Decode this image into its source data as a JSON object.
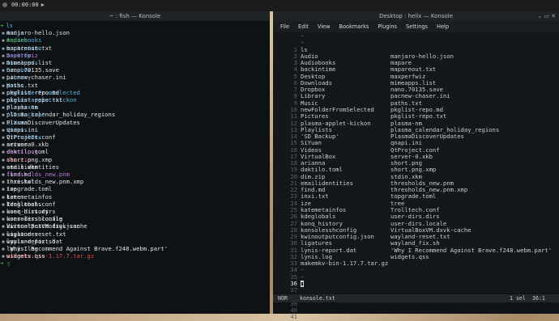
{
  "topbar": {
    "time": "00:00:00"
  },
  "left_window": {
    "title": "~ : fish — Konsole",
    "prompt_arrow": "➜",
    "command": "ls",
    "col1": [
      {
        "t": "Audio",
        "c": "dir"
      },
      {
        "t": "Audiobooks",
        "c": "dir"
      },
      {
        "t": "backintime",
        "c": "dir"
      },
      {
        "t": "Desktop",
        "c": "dir"
      },
      {
        "t": "Downloads",
        "c": "dir"
      },
      {
        "t": "Dropbox",
        "c": "dir"
      },
      {
        "t": "Library",
        "c": "dir"
      },
      {
        "t": "Music",
        "c": "dir"
      },
      {
        "t": "newFolderFromSelected",
        "c": "dir"
      },
      {
        "t": "plasma-applet-kickon",
        "c": "dir"
      },
      {
        "t": "Playlists",
        "c": "dir"
      },
      {
        "t": "'SD Backup'",
        "c": "dir"
      },
      {
        "t": "SiYuan",
        "c": "dir"
      },
      {
        "t": "Videos",
        "c": "dir"
      },
      {
        "t": "VirtualBox",
        "c": "dir"
      },
      {
        "t": "arianna",
        "c": "file"
      },
      {
        "t": "daktilo.toml",
        "c": "file"
      },
      {
        "t": "dim.zip",
        "c": "zip"
      },
      {
        "t": "emailidentities",
        "c": "file"
      },
      {
        "t": "find.md",
        "c": "file"
      },
      {
        "t": "inxi.txt",
        "c": "file"
      },
      {
        "t": "ize",
        "c": "file"
      },
      {
        "t": "katemetainfos",
        "c": "file"
      },
      {
        "t": "kdeglobals",
        "c": "file"
      },
      {
        "t": "konq_history",
        "c": "file"
      },
      {
        "t": "konsolesshconfig",
        "c": "file"
      },
      {
        "t": "kwinoutputconfig.json",
        "c": "file"
      },
      {
        "t": "ligatures",
        "c": "file"
      },
      {
        "t": "lynis-report.dat",
        "c": "file"
      },
      {
        "t": "lynis.log",
        "c": "file"
      },
      {
        "t": "makemkv-bin-1.17.7.tar.gz",
        "c": "zip"
      }
    ],
    "col2": [
      {
        "t": "manjaro-hello.json",
        "c": "file"
      },
      {
        "t": "mapare",
        "c": "exe"
      },
      {
        "t": "mapareout.txt",
        "c": "file"
      },
      {
        "t": "maperfwiz",
        "c": "img"
      },
      {
        "t": "mimeapps.list",
        "c": "file"
      },
      {
        "t": "nano.70135.save",
        "c": "file"
      },
      {
        "t": "pacnew-chaser.ini",
        "c": "file"
      },
      {
        "t": "paths.txt",
        "c": "file"
      },
      {
        "t": "pkglist-repo.md",
        "c": "file"
      },
      {
        "t": "pkglist-repo.txt",
        "c": "file"
      },
      {
        "t": "plasma-nm",
        "c": "file"
      },
      {
        "t": "plasma_calendar_holiday_regions",
        "c": "file"
      },
      {
        "t": "PlasmaDiscoverUpdates",
        "c": "file"
      },
      {
        "t": "qnapi.ini",
        "c": "file"
      },
      {
        "t": "QtProject.conf",
        "c": "file"
      },
      {
        "t": "server-0.xkb",
        "c": "file"
      },
      {
        "t": "short.png",
        "c": "img"
      },
      {
        "t": "short.png.xmp",
        "c": "file"
      },
      {
        "t": "stdin.xkm",
        "c": "file"
      },
      {
        "t": "thresholds_new.pnm",
        "c": "img"
      },
      {
        "t": "thresholds_new.pnm.xmp",
        "c": "file"
      },
      {
        "t": "topgrade.toml",
        "c": "file"
      },
      {
        "t": "tree",
        "c": "file"
      },
      {
        "t": "Trolltech.conf",
        "c": "file"
      },
      {
        "t": "user-dirs.dirs",
        "c": "file"
      },
      {
        "t": "user-dirs.locale",
        "c": "file"
      },
      {
        "t": "VirtualBoxVM.dxvk-cache",
        "c": "file"
      },
      {
        "t": "wayland-reset.txt",
        "c": "file"
      },
      {
        "t": "wayland_fix.sh",
        "c": "file"
      },
      {
        "t": "'Why I Recommend Against Brave.f248.webm.part'",
        "c": "file"
      },
      {
        "t": "widgets.qss",
        "c": "file"
      }
    ]
  },
  "right_window": {
    "title": "Desktop : helix — Konsole",
    "menu": [
      "File",
      "Edit",
      "View",
      "Bookmarks",
      "Plugins",
      "Settings",
      "Help"
    ],
    "lines": [
      {
        "n": "",
        "c1": "~",
        "c2": ""
      },
      {
        "n": "",
        "c1": "~",
        "c2": ""
      },
      {
        "n": "1",
        "c1": "ls",
        "c2": ""
      },
      {
        "n": "2",
        "c1": "Audio",
        "c2": "manjaro-hello.json"
      },
      {
        "n": "3",
        "c1": "Audiobooks",
        "c2": "mapare"
      },
      {
        "n": "4",
        "c1": "backintime",
        "c2": "mapareout.txt"
      },
      {
        "n": "5",
        "c1": "Desktop",
        "c2": "maxperfwiz"
      },
      {
        "n": "6",
        "c1": "Downloads",
        "c2": "mimeapps.list"
      },
      {
        "n": "7",
        "c1": "Dropbox",
        "c2": "nano.70135.save"
      },
      {
        "n": "8",
        "c1": "Library",
        "c2": "pacnew-chaser.ini"
      },
      {
        "n": "9",
        "c1": "Music",
        "c2": "paths.txt"
      },
      {
        "n": "10",
        "c1": "newFolderFromSelected",
        "c2": "pkglist-repo.md"
      },
      {
        "n": "11",
        "c1": "Pictures",
        "c2": "pkglist-repo.txt"
      },
      {
        "n": "12",
        "c1": "plasma-applet-kickon",
        "c2": "plasma-nm"
      },
      {
        "n": "13",
        "c1": "Playlists",
        "c2": "plasma_calendar_holiday_regions"
      },
      {
        "n": "14",
        "c1": "'SD Backup'",
        "c2": "PlasmaDiscoverUpdates"
      },
      {
        "n": "15",
        "c1": "SiYuan",
        "c2": "qnapi.ini"
      },
      {
        "n": "16",
        "c1": "Videos",
        "c2": "QtProject.conf"
      },
      {
        "n": "17",
        "c1": "VirtualBox",
        "c2": "server-0.xkb"
      },
      {
        "n": "18",
        "c1": "arianna",
        "c2": "short.png"
      },
      {
        "n": "19",
        "c1": "daktilo.toml",
        "c2": "short.png.xmp"
      },
      {
        "n": "20",
        "c1": "dim.zip",
        "c2": "stdin.xkm"
      },
      {
        "n": "21",
        "c1": "emailidentities",
        "c2": "thresholds_new.pnm"
      },
      {
        "n": "22",
        "c1": "find.md",
        "c2": "thresholds_new.pnm.xmp"
      },
      {
        "n": "23",
        "c1": "inxi.txt",
        "c2": "topgrade.toml"
      },
      {
        "n": "24",
        "c1": "ize",
        "c2": "tree"
      },
      {
        "n": "25",
        "c1": "katemetainfos",
        "c2": "Trolltech.conf"
      },
      {
        "n": "26",
        "c1": "kdeglobals",
        "c2": "user-dirs.dirs"
      },
      {
        "n": "27",
        "c1": "konq_history",
        "c2": "user-dirs.locale"
      },
      {
        "n": "28",
        "c1": "konsolesshconfig",
        "c2": "VirtualBoxVM.dxvk-cache"
      },
      {
        "n": "29",
        "c1": "kwinoutputconfig.json",
        "c2": "wayland-reset.txt"
      },
      {
        "n": "30",
        "c1": "ligatures",
        "c2": "wayland_fix.sh"
      },
      {
        "n": "31",
        "c1": "lynis-report.dat",
        "c2": "'Why I Recommend Against Brave.f248.webm.part'"
      },
      {
        "n": "32",
        "c1": "lynis.log",
        "c2": "widgets.qss"
      },
      {
        "n": "33",
        "c1": "makemkv-bin-1.17.7.tar.gz",
        "c2": ""
      },
      {
        "n": "34",
        "c1": "~",
        "c2": ""
      },
      {
        "n": "35",
        "c1": "~",
        "c2": ""
      },
      {
        "n": "36",
        "c1": "▮",
        "c2": ""
      },
      {
        "n": "37",
        "c1": "",
        "c2": ""
      },
      {
        "n": "38",
        "c1": "",
        "c2": ""
      },
      {
        "n": "39",
        "c1": "",
        "c2": ""
      },
      {
        "n": "40",
        "c1": "",
        "c2": ""
      },
      {
        "n": "41",
        "c1": "",
        "c2": ""
      }
    ],
    "status": {
      "mode": "NOR",
      "file": "konsole.txt",
      "sel": "1 sel",
      "pos": "36:1"
    }
  }
}
